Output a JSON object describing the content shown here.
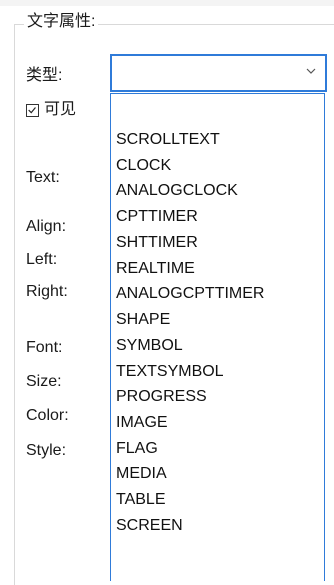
{
  "group": {
    "title": "文字属性:"
  },
  "type_field": {
    "label": "类型:",
    "value": ""
  },
  "visible": {
    "label": "可见",
    "checked": true
  },
  "properties": {
    "text": "Text:",
    "align": "Align:",
    "left": "Left:",
    "right": "Right:",
    "font": "Font:",
    "size": "Size:",
    "color": "Color:",
    "style": "Style:"
  },
  "dropdown": {
    "options": [
      "SCROLLTEXT",
      "CLOCK",
      "ANALOGCLOCK",
      "CPTTIMER",
      "SHTTIMER",
      "REALTIME",
      "ANALOGCPTTIMER",
      "SHAPE",
      "SYMBOL",
      "TEXTSYMBOL",
      "PROGRESS",
      "IMAGE",
      "FLAG",
      "MEDIA",
      "TABLE",
      "SCREEN"
    ]
  },
  "colors": {
    "accent": "#2f7bd9",
    "group_border": "#d9d9d9"
  },
  "icons": {
    "combo_arrow": "chevron-down-icon",
    "checkbox": "checkmark-icon"
  }
}
